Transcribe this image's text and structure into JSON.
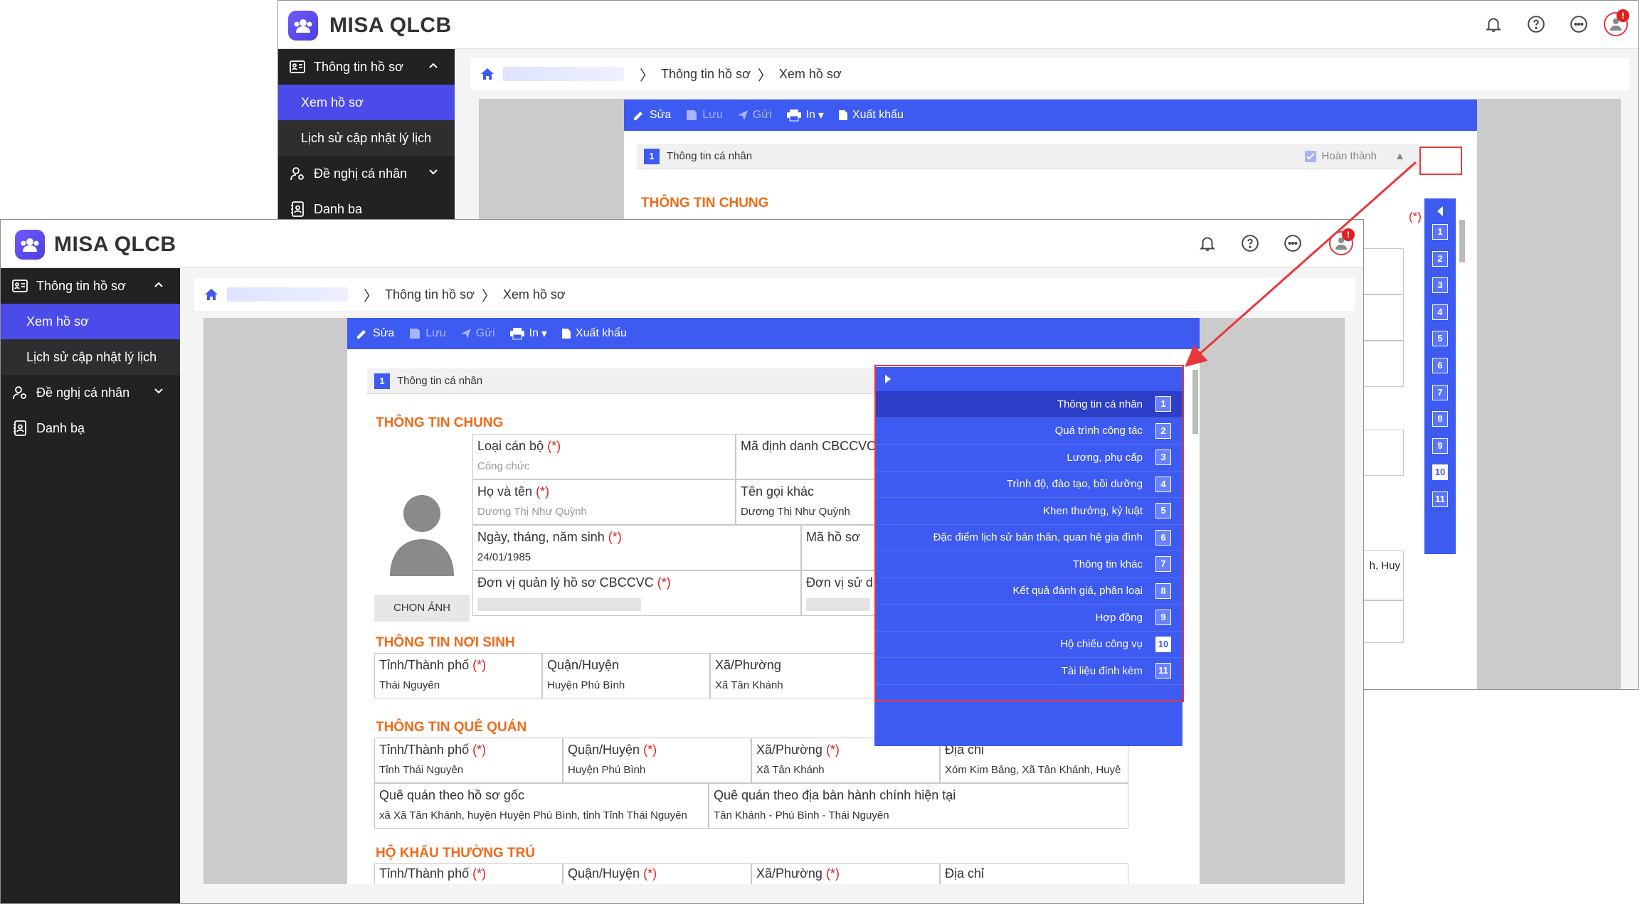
{
  "app": {
    "name": "MISA QLCB"
  },
  "sidebar": {
    "group1_label": "Thông tin hồ sơ",
    "sub1": "Xem hồ sơ",
    "sub2": "Lịch sử cập nhật lý lịch",
    "group2_label": "Đề nghị cá nhân",
    "group3_label": "Danh bạ",
    "group3_partial": "Danh ba"
  },
  "breadcrumb": {
    "item1": "Thông tin hồ sơ",
    "item2": "Xem hồ sơ"
  },
  "toolbar": {
    "edit": "Sửa",
    "save": "Lưu",
    "send": "Gửi",
    "print": "In",
    "export": "Xuất khẩu"
  },
  "section": {
    "number": "1",
    "title": "Thông tin cá nhân",
    "complete_label": "Hoàn thành"
  },
  "profile": {
    "general_title": "THÔNG TIN CHUNG",
    "choose_photo": "CHỌN ẢNH",
    "type_label": "Loại cán bộ",
    "type_value": "Công chức",
    "id_label": "Mã định danh CBCCVC",
    "name_label": "Họ và tên",
    "name_value": "Dương Thị Như Quỳnh",
    "alias_label": "Tên gọi khác",
    "alias_value": "Dương Thị Như Quỳnh",
    "dob_label": "Ngày, tháng, năm sinh",
    "dob_value": "24/01/1985",
    "code_label": "Mã hồ sơ",
    "unit_label": "Đơn vị quản lý hồ sơ CBCCVC",
    "unit_use_label": "Đơn vị sử d",
    "required_mark": "(*)",
    "birth_title": "THÔNG TIN NƠI SINH",
    "province_label": "Tỉnh/Thành phố",
    "district_label": "Quận/Huyện",
    "ward_label": "Xã/Phường",
    "address_label": "Địa chỉ",
    "birth_province": "Thái Nguyên",
    "birth_district": "Huyện Phú Bình",
    "birth_ward": "Xã Tân Khánh",
    "home_title": "THÔNG TIN QUÊ QUÁN",
    "home_province": "Tỉnh Thái Nguyên",
    "home_district": "Huyện Phú Bình",
    "home_ward": "Xã Tân Khánh",
    "home_address": "Xóm Kim Bảng, Xã Tân Khánh, Huyệ",
    "orig_label": "Quê quán theo hồ sơ gốc",
    "orig_value": "xã Xã Tân Khánh, huyện Huyện Phú Bình, tỉnh Tỉnh Thái Nguyên",
    "current_label": "Quê quán theo địa bàn hành chính hiện tại",
    "current_value": "Tân Khánh - Phú Bình - Thái Nguyên",
    "household_title": "HỘ KHẨU THƯỜNG TRÚ",
    "back_partial": "h, Huy"
  },
  "nav_numbers": [
    "1",
    "2",
    "3",
    "4",
    "5",
    "6",
    "7",
    "8",
    "9",
    "10",
    "11"
  ],
  "nav_panel": [
    {
      "label": "Thông tin cá nhân",
      "num": "1"
    },
    {
      "label": "Quá trình công tác",
      "num": "2"
    },
    {
      "label": "Lương, phụ cấp",
      "num": "3"
    },
    {
      "label": "Trình độ, đào tạo, bồi dưỡng",
      "num": "4"
    },
    {
      "label": "Khen thưởng, kỷ luật",
      "num": "5"
    },
    {
      "label": "Đặc điểm lịch sử bản thân, quan hệ gia đình",
      "num": "6"
    },
    {
      "label": "Thông tin khác",
      "num": "7"
    },
    {
      "label": "Kết quả đánh giá, phân loại",
      "num": "8"
    },
    {
      "label": "Hợp đồng",
      "num": "9"
    },
    {
      "label": "Hộ chiếu công vụ",
      "num": "10"
    },
    {
      "label": "Tài liệu đính kèm",
      "num": "11"
    }
  ],
  "notifications": {
    "badge": "!"
  },
  "colors": {
    "accent": "#3d5af1",
    "sidebar": "#222222",
    "section_title": "#f06a1a",
    "highlight": "#e8373b"
  }
}
